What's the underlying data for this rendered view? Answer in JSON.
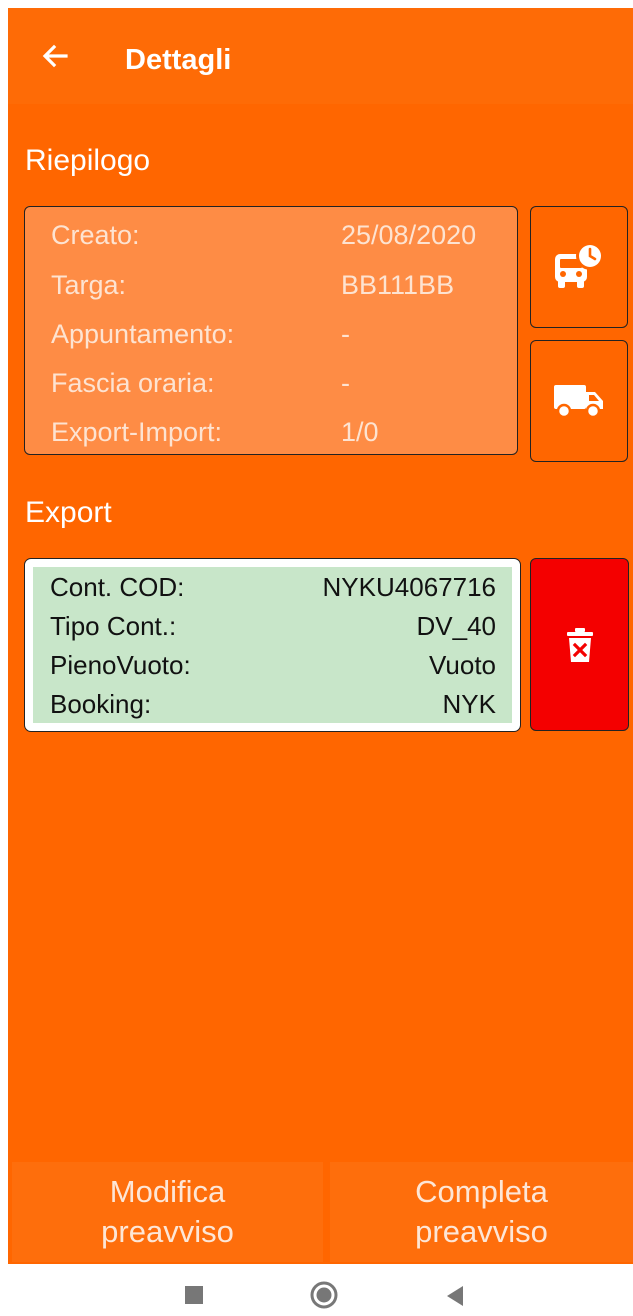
{
  "appbar": {
    "title": "Dettagli",
    "back_icon": "arrow-left-icon"
  },
  "summary": {
    "title": "Riepilogo",
    "rows": [
      {
        "label": "Creato:",
        "value": "25/08/2020"
      },
      {
        "label": "Targa:",
        "value": "BB111BB"
      },
      {
        "label": "Appuntamento:",
        "value": "-"
      },
      {
        "label": "Fascia oraria:",
        "value": "-"
      },
      {
        "label": "Export-Import:",
        "value": "1/0"
      }
    ],
    "buttons": [
      "truck-clock-icon",
      "truck-icon"
    ]
  },
  "export": {
    "title": "Export",
    "rows": [
      {
        "label": "Cont. COD:",
        "value": "NYKU4067716"
      },
      {
        "label": "Tipo Cont.:",
        "value": "DV_40"
      },
      {
        "label": "PienoVuoto:",
        "value": "Vuoto"
      },
      {
        "label": "Booking:",
        "value": "NYK"
      }
    ],
    "delete_icon": "trash-x-icon"
  },
  "actions": {
    "modify": {
      "line1": "Modifica",
      "line2": "preavviso"
    },
    "complete": {
      "line1": "Completa",
      "line2": "preavviso"
    }
  },
  "colors": {
    "primary": "#ff6600",
    "card": "#fe8c45",
    "export_bg": "#c8e6c9",
    "delete": "#f40000"
  }
}
